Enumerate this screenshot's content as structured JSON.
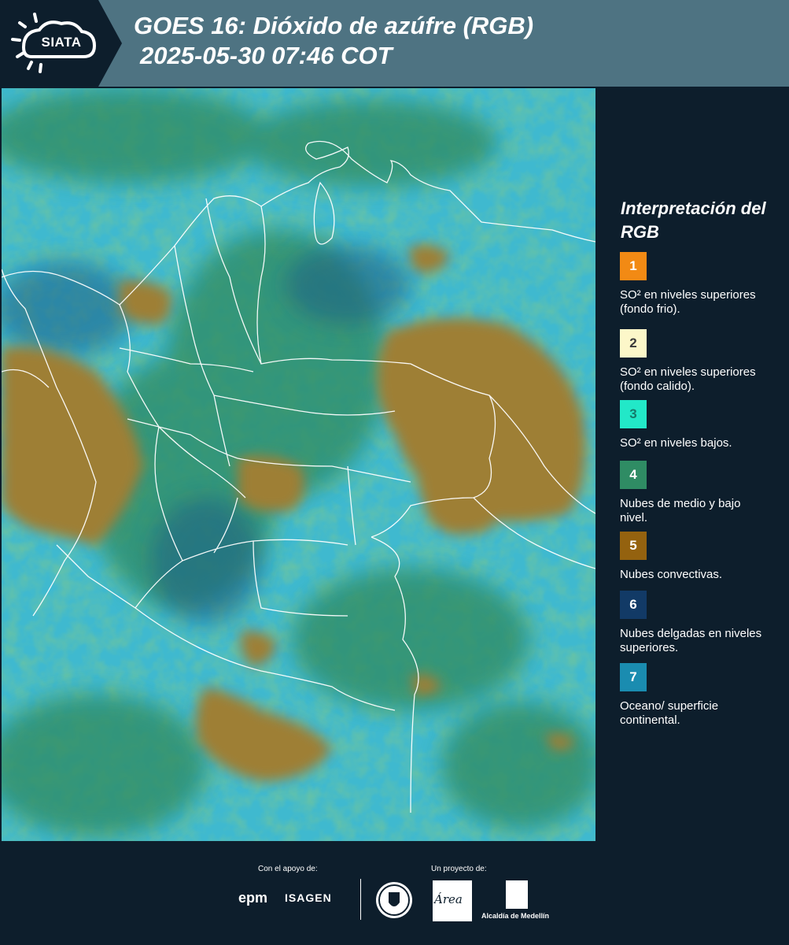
{
  "header": {
    "logo_text": "SIATA",
    "title_line1": "GOES 16: Dióxido de azúfre (RGB)",
    "title_line2": "2025-05-30 07:46 COT"
  },
  "legend": {
    "title": "Interpretación del RGB",
    "items": [
      {
        "number": "1",
        "color": "#f28a14",
        "label": "SO² en niveles superiores (fondo frio)."
      },
      {
        "number": "2",
        "color": "#fcf7c9",
        "label": "SO² en niveles superiores (fondo calido)."
      },
      {
        "number": "3",
        "color": "#22e8c8",
        "label": "SO² en niveles bajos."
      },
      {
        "number": "4",
        "color": "#2f8c64",
        "label": "Nubes de medio y bajo nivel."
      },
      {
        "number": "5",
        "color": "#94620f",
        "label": "Nubes convectivas."
      },
      {
        "number": "6",
        "color": "#123a66",
        "label": "Nubes delgadas en niveles superiores."
      },
      {
        "number": "7",
        "color": "#1a8cb0",
        "label": "Oceano/ superficie continental."
      }
    ]
  },
  "map": {
    "product": "GOES 16 SO2 RGB",
    "colors": {
      "background": "#3fb9cf",
      "convective": "#9b7f3a",
      "mid_low_cloud": "#3c9a6a",
      "thin_high": "#1f6f8f"
    }
  },
  "footer": {
    "support_label": "Con el apoyo de:",
    "project_label": "Un proyecto de:",
    "sponsors": [
      "epm",
      "ISAGEN"
    ],
    "partners": [
      "Área Metropolitana Valle de Aburrá",
      "Alcaldía de Medellín"
    ]
  }
}
